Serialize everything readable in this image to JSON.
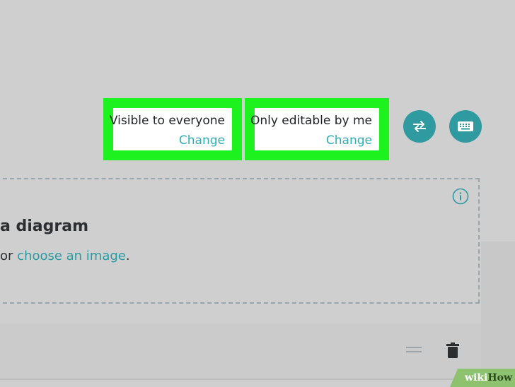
{
  "visibility": {
    "label": "Visible to everyone",
    "change_label": "Change"
  },
  "editability": {
    "label": "Only editable by me",
    "change_label": "Change"
  },
  "toolbar": {
    "swap_icon": "swap-arrows-icon",
    "keyboard_icon": "keyboard-icon",
    "button_color": "#2f9aa0"
  },
  "drop_area": {
    "heading": "a diagram",
    "prefix": "or ",
    "link": "choose an image",
    "suffix": ".",
    "info_icon": "info-icon"
  },
  "step_card": {
    "handle_icon": "drag-handle-icon",
    "delete_icon": "trash-icon"
  },
  "watermark": {
    "wiki": "wiki",
    "how": "How"
  },
  "colors": {
    "highlight": "#1ef21e",
    "accent": "#2bb0b6",
    "background": "#cfcfcf"
  }
}
